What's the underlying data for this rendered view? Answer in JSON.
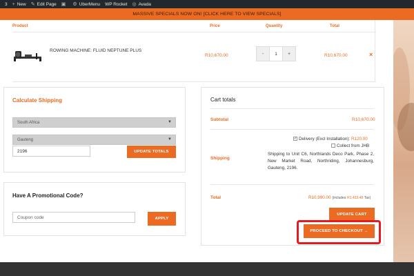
{
  "admin_bar": {
    "items": [
      "3",
      "New",
      "Edit Page",
      "UberMenu",
      "WP Rocket",
      "Avada"
    ]
  },
  "promo_banner": "MASSIVE SPECIALS NOW ON! [CLICK HERE TO VIEW SPECIALS]",
  "cart": {
    "headers": {
      "product": "Product",
      "price": "Price",
      "quantity": "Quantity",
      "total": "Total"
    },
    "item": {
      "name": "ROWING MACHINE: FLUID NEPTUNE PLUS",
      "price": "R10,670.00",
      "quantity": "1",
      "subtotal": "R10,670.00",
      "minus": "-",
      "plus": "+",
      "remove": "×"
    }
  },
  "shipping_calc": {
    "title": "Calculate Shipping",
    "country": "South Africa",
    "province": "Gauteng",
    "postcode": "2196",
    "update_button": "UPDATE TOTALS"
  },
  "promo_code": {
    "title": "Have A Promotional Code?",
    "placeholder": "Coupon code",
    "apply_button": "APPLY"
  },
  "cart_totals": {
    "title": "Cart totals",
    "subtotal_label": "Subtotal",
    "subtotal_value": "R10,670.00",
    "shipping_label": "Shipping",
    "delivery_option": "Delivery (Excl Installation):",
    "delivery_price": "R120.00",
    "collect_option": "Collect from JHB",
    "shipping_to": "Shipping to Unit C6, Northlands Deco Park, Phase 2, New Market Road, Northriding, Johannesburg, Gauteng, 2196.",
    "total_label": "Total",
    "total_value": "R10,990.00",
    "tax_prefix": "(includes",
    "tax_value": "R1,433.48",
    "tax_suffix": "Tax)",
    "update_cart_button": "UPDATE CART",
    "checkout_button": "PROCEED TO CHECKOUT →"
  },
  "colors": {
    "accent": "#ea6b21",
    "admin_bar": "#23282d",
    "highlight": "#e31b23"
  }
}
